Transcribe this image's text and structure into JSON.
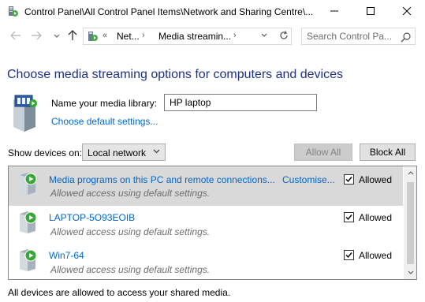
{
  "window": {
    "title": "Control Panel\\All Control Panel Items\\Network and Sharing Centre\\...",
    "app_icon": "media-streaming-icon",
    "controls": [
      "minimize-icon",
      "maximize-icon",
      "close-icon"
    ]
  },
  "navigation": {
    "back": "arrow-left-icon",
    "forward": "arrow-right-icon",
    "recent": "chevron-down-icon",
    "up": "arrow-up-icon",
    "address": {
      "overflow": "«",
      "crumb1": "Net...",
      "separator": "›",
      "crumb2": "Media streamin...",
      "dropdown": "chevron-down-icon"
    },
    "refresh": "refresh-icon",
    "search_placeholder": "Search Control Pa..."
  },
  "main": {
    "heading": "Choose media streaming options for computers and devices",
    "library_label": "Name your media library:",
    "library_value": "HP laptop",
    "default_settings_link": "Choose default settings...",
    "show_devices_label": "Show devices on:",
    "show_devices_value": "Local network",
    "allow_all": "Allow All",
    "block_all": "Block All"
  },
  "devices": [
    {
      "name": "Media programs on this PC and remote connections...",
      "customise": "Customise...",
      "description": "Allowed access using default settings.",
      "allowed": true,
      "status_label": "Allowed",
      "selected": true
    },
    {
      "name": "LAPTOP-5O93EOIB",
      "customise": "",
      "description": "Allowed access using default settings.",
      "allowed": true,
      "status_label": "Allowed",
      "selected": false
    },
    {
      "name": "Win7-64",
      "customise": "",
      "description": "Allowed access using default settings.",
      "allowed": true,
      "status_label": "Allowed",
      "selected": false
    }
  ],
  "footer": "All devices are allowed to access your shared media.",
  "colors": {
    "heading": "#1e3287",
    "link": "#0066cc",
    "selection": "#d9d9d9"
  }
}
